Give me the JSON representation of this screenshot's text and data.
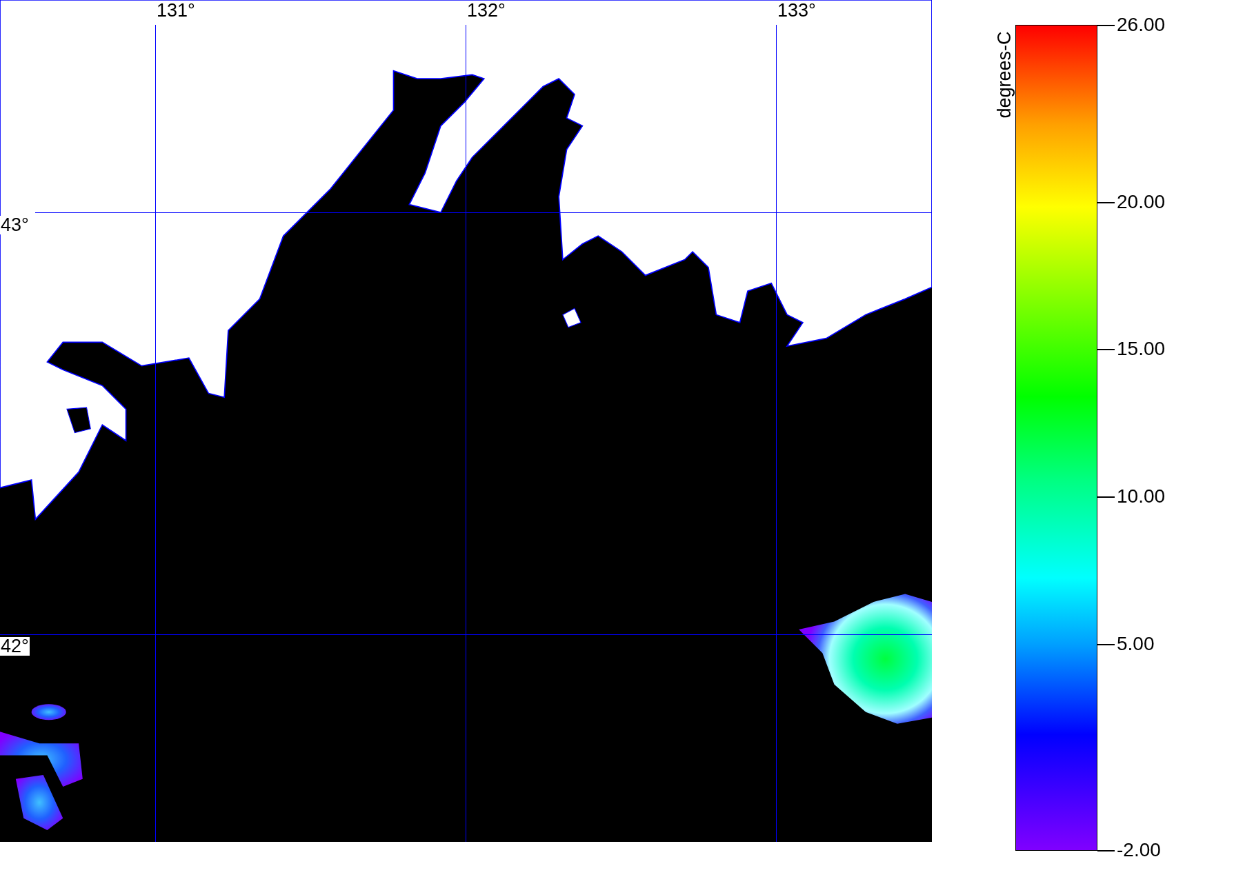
{
  "map": {
    "longitude_labels": [
      "131°",
      "132°",
      "133°"
    ],
    "latitude_labels": [
      "43°",
      "42°"
    ]
  },
  "colorbar": {
    "title": "degrees-C",
    "tick_labels": [
      "26.00",
      "20.00",
      "15.00",
      "10.00",
      "5.00",
      "-2.00"
    ]
  }
}
